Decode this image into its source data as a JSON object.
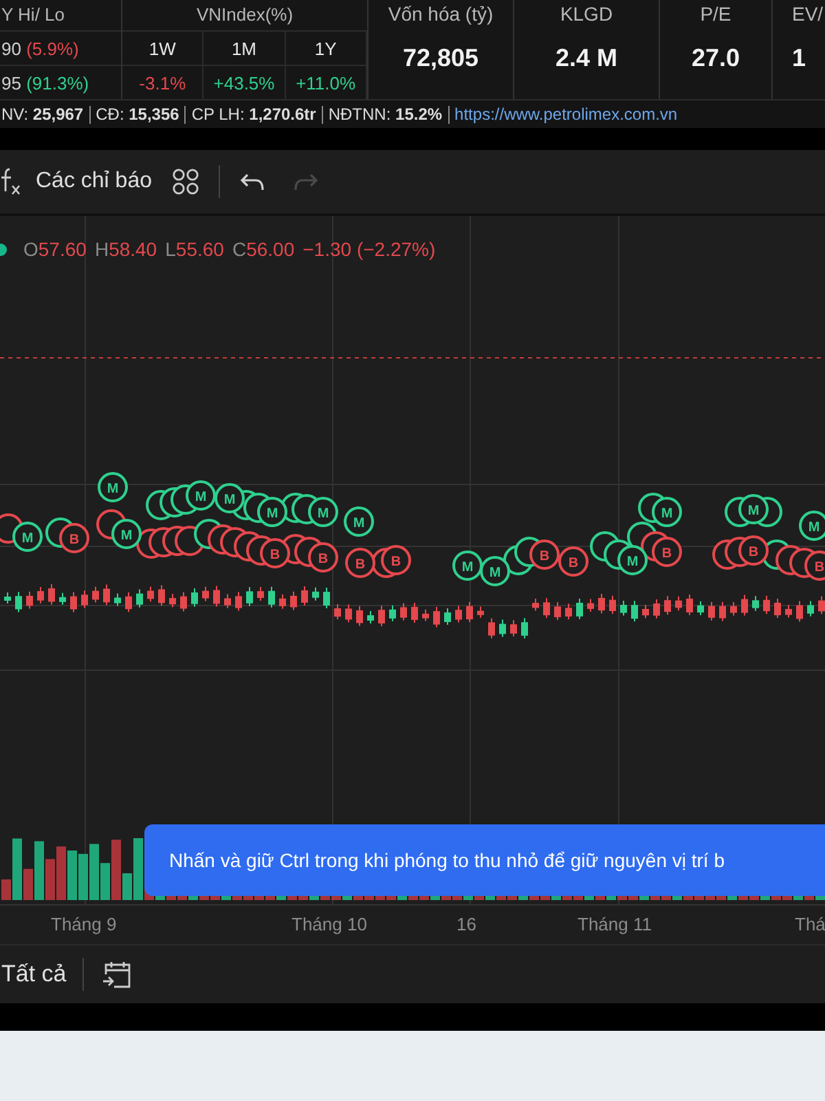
{
  "header": {
    "hi_lo": {
      "title": "Y Hi/ Lo",
      "rows": [
        {
          "value": "90",
          "change": "(5.9%)",
          "color": "#e5484d"
        },
        {
          "value": "95",
          "change": "(91.3%)",
          "color": "#2fd08e"
        }
      ]
    },
    "vnindex": {
      "title": "VNIndex(%)",
      "periods": [
        {
          "label": "1W",
          "value": "-3.1%",
          "color": "#e5484d"
        },
        {
          "label": "1M",
          "value": "+43.5%",
          "color": "#2fd08e"
        },
        {
          "label": "1Y",
          "value": "+11.0%",
          "color": "#2fd08e"
        }
      ]
    },
    "stats": [
      {
        "label": "Vốn hóa (tỷ)",
        "value": "72,805"
      },
      {
        "label": "KLGD",
        "value": "2.4 M"
      },
      {
        "label": "P/E",
        "value": "27.0"
      },
      {
        "label": "EV/",
        "value": "1"
      }
    ]
  },
  "info_bar": {
    "items": [
      {
        "label": "NV:",
        "value": "25,967"
      },
      {
        "label": "CĐ:",
        "value": "15,356"
      },
      {
        "label": "CP LH:",
        "value": "1,270.6tr"
      },
      {
        "label": "NĐTNN:",
        "value": "15.2%"
      }
    ],
    "link": "https://www.petrolimex.com.vn"
  },
  "toolbar": {
    "indicators": "Các chỉ báo",
    "tools": [
      {
        "kind": "undo",
        "disabled": false
      },
      {
        "kind": "redo",
        "disabled": true
      }
    ]
  },
  "legend": {
    "values": [
      {
        "label": "O",
        "value": "57.60"
      },
      {
        "label": "H",
        "value": "58.40"
      },
      {
        "label": "L",
        "value": "55.60"
      },
      {
        "label": "C",
        "value": "56.00"
      }
    ],
    "change": "−1.30 (−2.27%)"
  },
  "markers": [
    {
      "label": "M",
      "color": "#2fd08e"
    },
    {
      "label": "M",
      "color": "#2fd08e"
    },
    {
      "label": "B",
      "color": "#e5484d"
    },
    {
      "label": "M",
      "color": "#2fd08e"
    },
    {
      "label": "M",
      "color": "#2fd08e"
    },
    {
      "label": "M",
      "color": "#2fd08e"
    },
    {
      "label": "M",
      "color": "#2fd08e"
    },
    {
      "label": "M",
      "color": "#2fd08e"
    },
    {
      "label": "M",
      "color": "#2fd08e"
    },
    {
      "label": "B",
      "color": "#e5484d"
    },
    {
      "label": "B",
      "color": "#e5484d"
    },
    {
      "label": "B",
      "color": "#e5484d"
    },
    {
      "label": "B",
      "color": "#e5484d"
    },
    {
      "label": "M",
      "color": "#2fd08e"
    },
    {
      "label": "M",
      "color": "#2fd08e"
    },
    {
      "label": "B",
      "color": "#e5484d"
    },
    {
      "label": "B",
      "color": "#e5484d"
    },
    {
      "label": "M",
      "color": "#2fd08e"
    },
    {
      "label": "M",
      "color": "#2fd08e"
    },
    {
      "label": "B",
      "color": "#e5484d"
    },
    {
      "label": "M",
      "color": "#2fd08e"
    },
    {
      "label": "B",
      "color": "#e5484d"
    },
    {
      "label": "M",
      "color": "#2fd08e"
    },
    {
      "label": "B",
      "color": "#e5484d"
    }
  ],
  "hint": "Nhấn và giữ Ctrl trong khi phóng to thu nhỏ để giữ nguyên vị trí b",
  "x_axis": [
    "Tháng 9",
    "Tháng 10",
    "16",
    "Tháng 11",
    "Thá"
  ],
  "bottom_bar": {
    "range": "Tất cả"
  }
}
